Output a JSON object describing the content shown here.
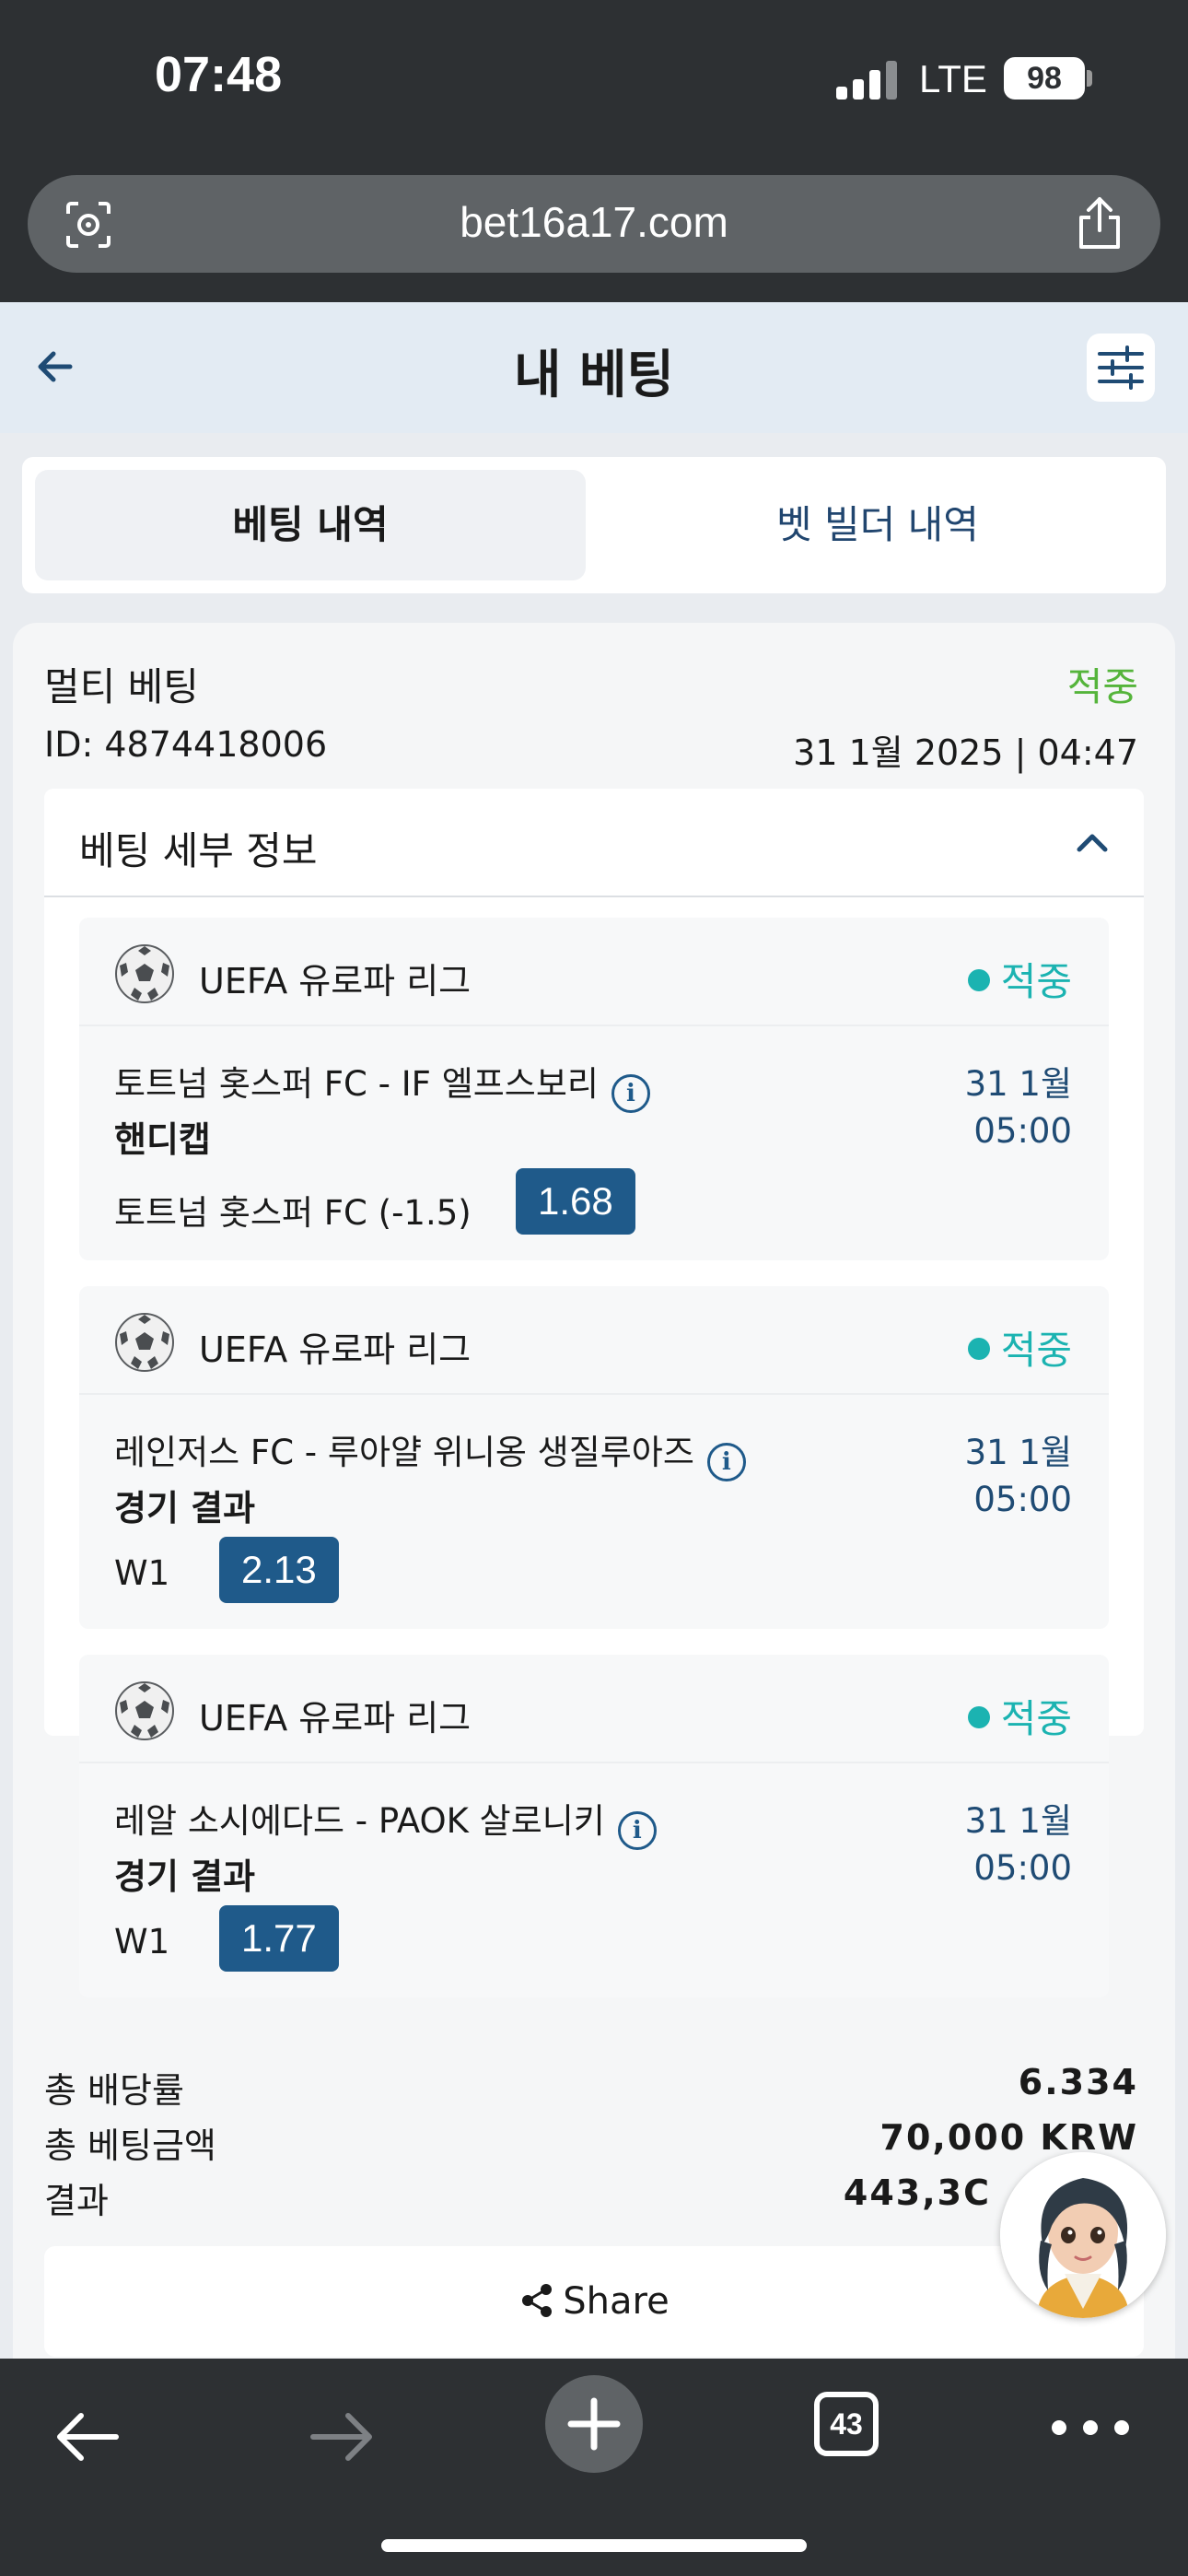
{
  "status_bar": {
    "time": "07:48",
    "network": "LTE",
    "battery": "98"
  },
  "browser": {
    "url": "bet16a17.com",
    "tab_count": "43"
  },
  "header": {
    "title": "내 베팅"
  },
  "tabs": [
    {
      "label": "베팅 내역",
      "active": true
    },
    {
      "label": "벳 빌더 내역",
      "active": false
    }
  ],
  "bet": {
    "type": "멀티 베팅",
    "status": "적중",
    "id": "ID: 4874418006",
    "date": "31 1월 2025 | 04:47",
    "details_title": "베팅 세부 정보",
    "events": [
      {
        "league": "UEFA 유로파 리그",
        "status": "적중",
        "match": "토트넘 홋스퍼 FC - IF 엘프스보리",
        "market": "핸디캡",
        "date": "31 1월",
        "time": "05:00",
        "selection": "토트넘 홋스퍼 FC (-1.5)",
        "odds": "1.68"
      },
      {
        "league": "UEFA 유로파 리그",
        "status": "적중",
        "match": "레인저스 FC - 루아얄 위니옹 생질루아즈",
        "market": "경기 결과",
        "date": "31 1월",
        "time": "05:00",
        "selection": "W1",
        "odds": "2.13"
      },
      {
        "league": "UEFA 유로파 리그",
        "status": "적중",
        "match": "레알 소시에다드 - PAOK 살로니키",
        "market": "경기 결과",
        "date": "31 1월",
        "time": "05:00",
        "selection": "W1",
        "odds": "1.77"
      }
    ],
    "summary": {
      "total_odds_label": "총 배당률",
      "total_odds": "6.334",
      "total_stake_label": "총 베팅금액",
      "total_stake": "70,000 KRW",
      "result_label": "결과",
      "result": "443,3C"
    },
    "share_label": "Share"
  },
  "colors": {
    "accent": "#1f5a8a",
    "win_green": "#55b43b",
    "win_teal": "#1bb3b1",
    "chrome": "#2d3033"
  }
}
